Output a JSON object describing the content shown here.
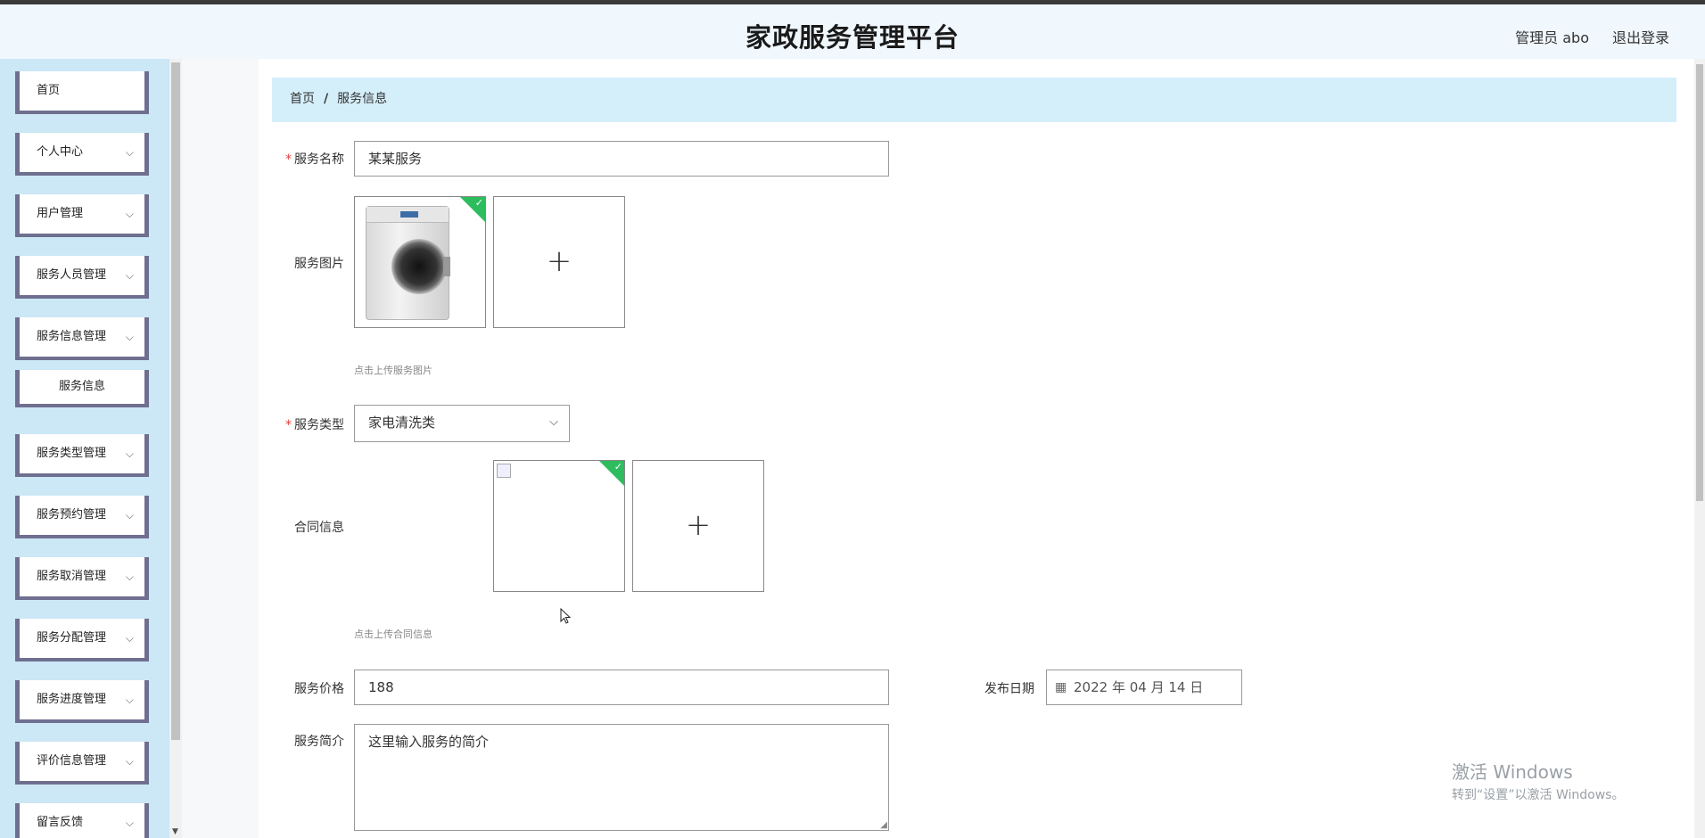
{
  "header": {
    "title": "家政服务管理平台",
    "user": "管理员 abo",
    "logout": "退出登录"
  },
  "sidebar": {
    "items": [
      {
        "label": "首页",
        "has_chevron": false
      },
      {
        "label": "个人中心",
        "has_chevron": true
      },
      {
        "label": "用户管理",
        "has_chevron": true
      },
      {
        "label": "服务人员管理",
        "has_chevron": true
      },
      {
        "label": "服务信息管理",
        "has_chevron": true
      },
      {
        "label": "服务类型管理",
        "has_chevron": true
      },
      {
        "label": "服务预约管理",
        "has_chevron": true
      },
      {
        "label": "服务取消管理",
        "has_chevron": true
      },
      {
        "label": "服务分配管理",
        "has_chevron": true
      },
      {
        "label": "服务进度管理",
        "has_chevron": true
      },
      {
        "label": "评价信息管理",
        "has_chevron": true
      },
      {
        "label": "留言反馈",
        "has_chevron": true
      }
    ],
    "submenu": {
      "label": "服务信息"
    }
  },
  "breadcrumb": {
    "home": "首页",
    "separator": "/",
    "current": "服务信息"
  },
  "form": {
    "service_name": {
      "label": "服务名称",
      "required": true,
      "value": "某某服务"
    },
    "service_image": {
      "label": "服务图片",
      "hint": "点击上传服务图片",
      "plus": "+",
      "check": "✓"
    },
    "service_type": {
      "label": "服务类型",
      "required": true,
      "value": "家电清洗类"
    },
    "contract": {
      "label": "合同信息",
      "hint": "点击上传合同信息",
      "plus": "+",
      "check": "✓"
    },
    "price": {
      "label": "服务价格",
      "value": "188"
    },
    "publish_date": {
      "label": "发布日期",
      "value": "2022 年 04 月 14 日"
    },
    "intro": {
      "label": "服务简介",
      "value": "这里输入服务的简介"
    }
  },
  "icons": {
    "chevron": "chevron-down-icon",
    "calendar": "calendar-icon",
    "plus": "plus-icon",
    "check": "check-icon"
  },
  "colors": {
    "sidebar_bg": "#cce7f6",
    "menu_border": "#6f6f90",
    "breadcrumb_bg": "#d5effa",
    "success": "#2dbd5e",
    "required": "#e23b3b"
  },
  "watermark": {
    "line1": "激活 Windows",
    "line2": "转到“设置”以激活 Windows。"
  }
}
